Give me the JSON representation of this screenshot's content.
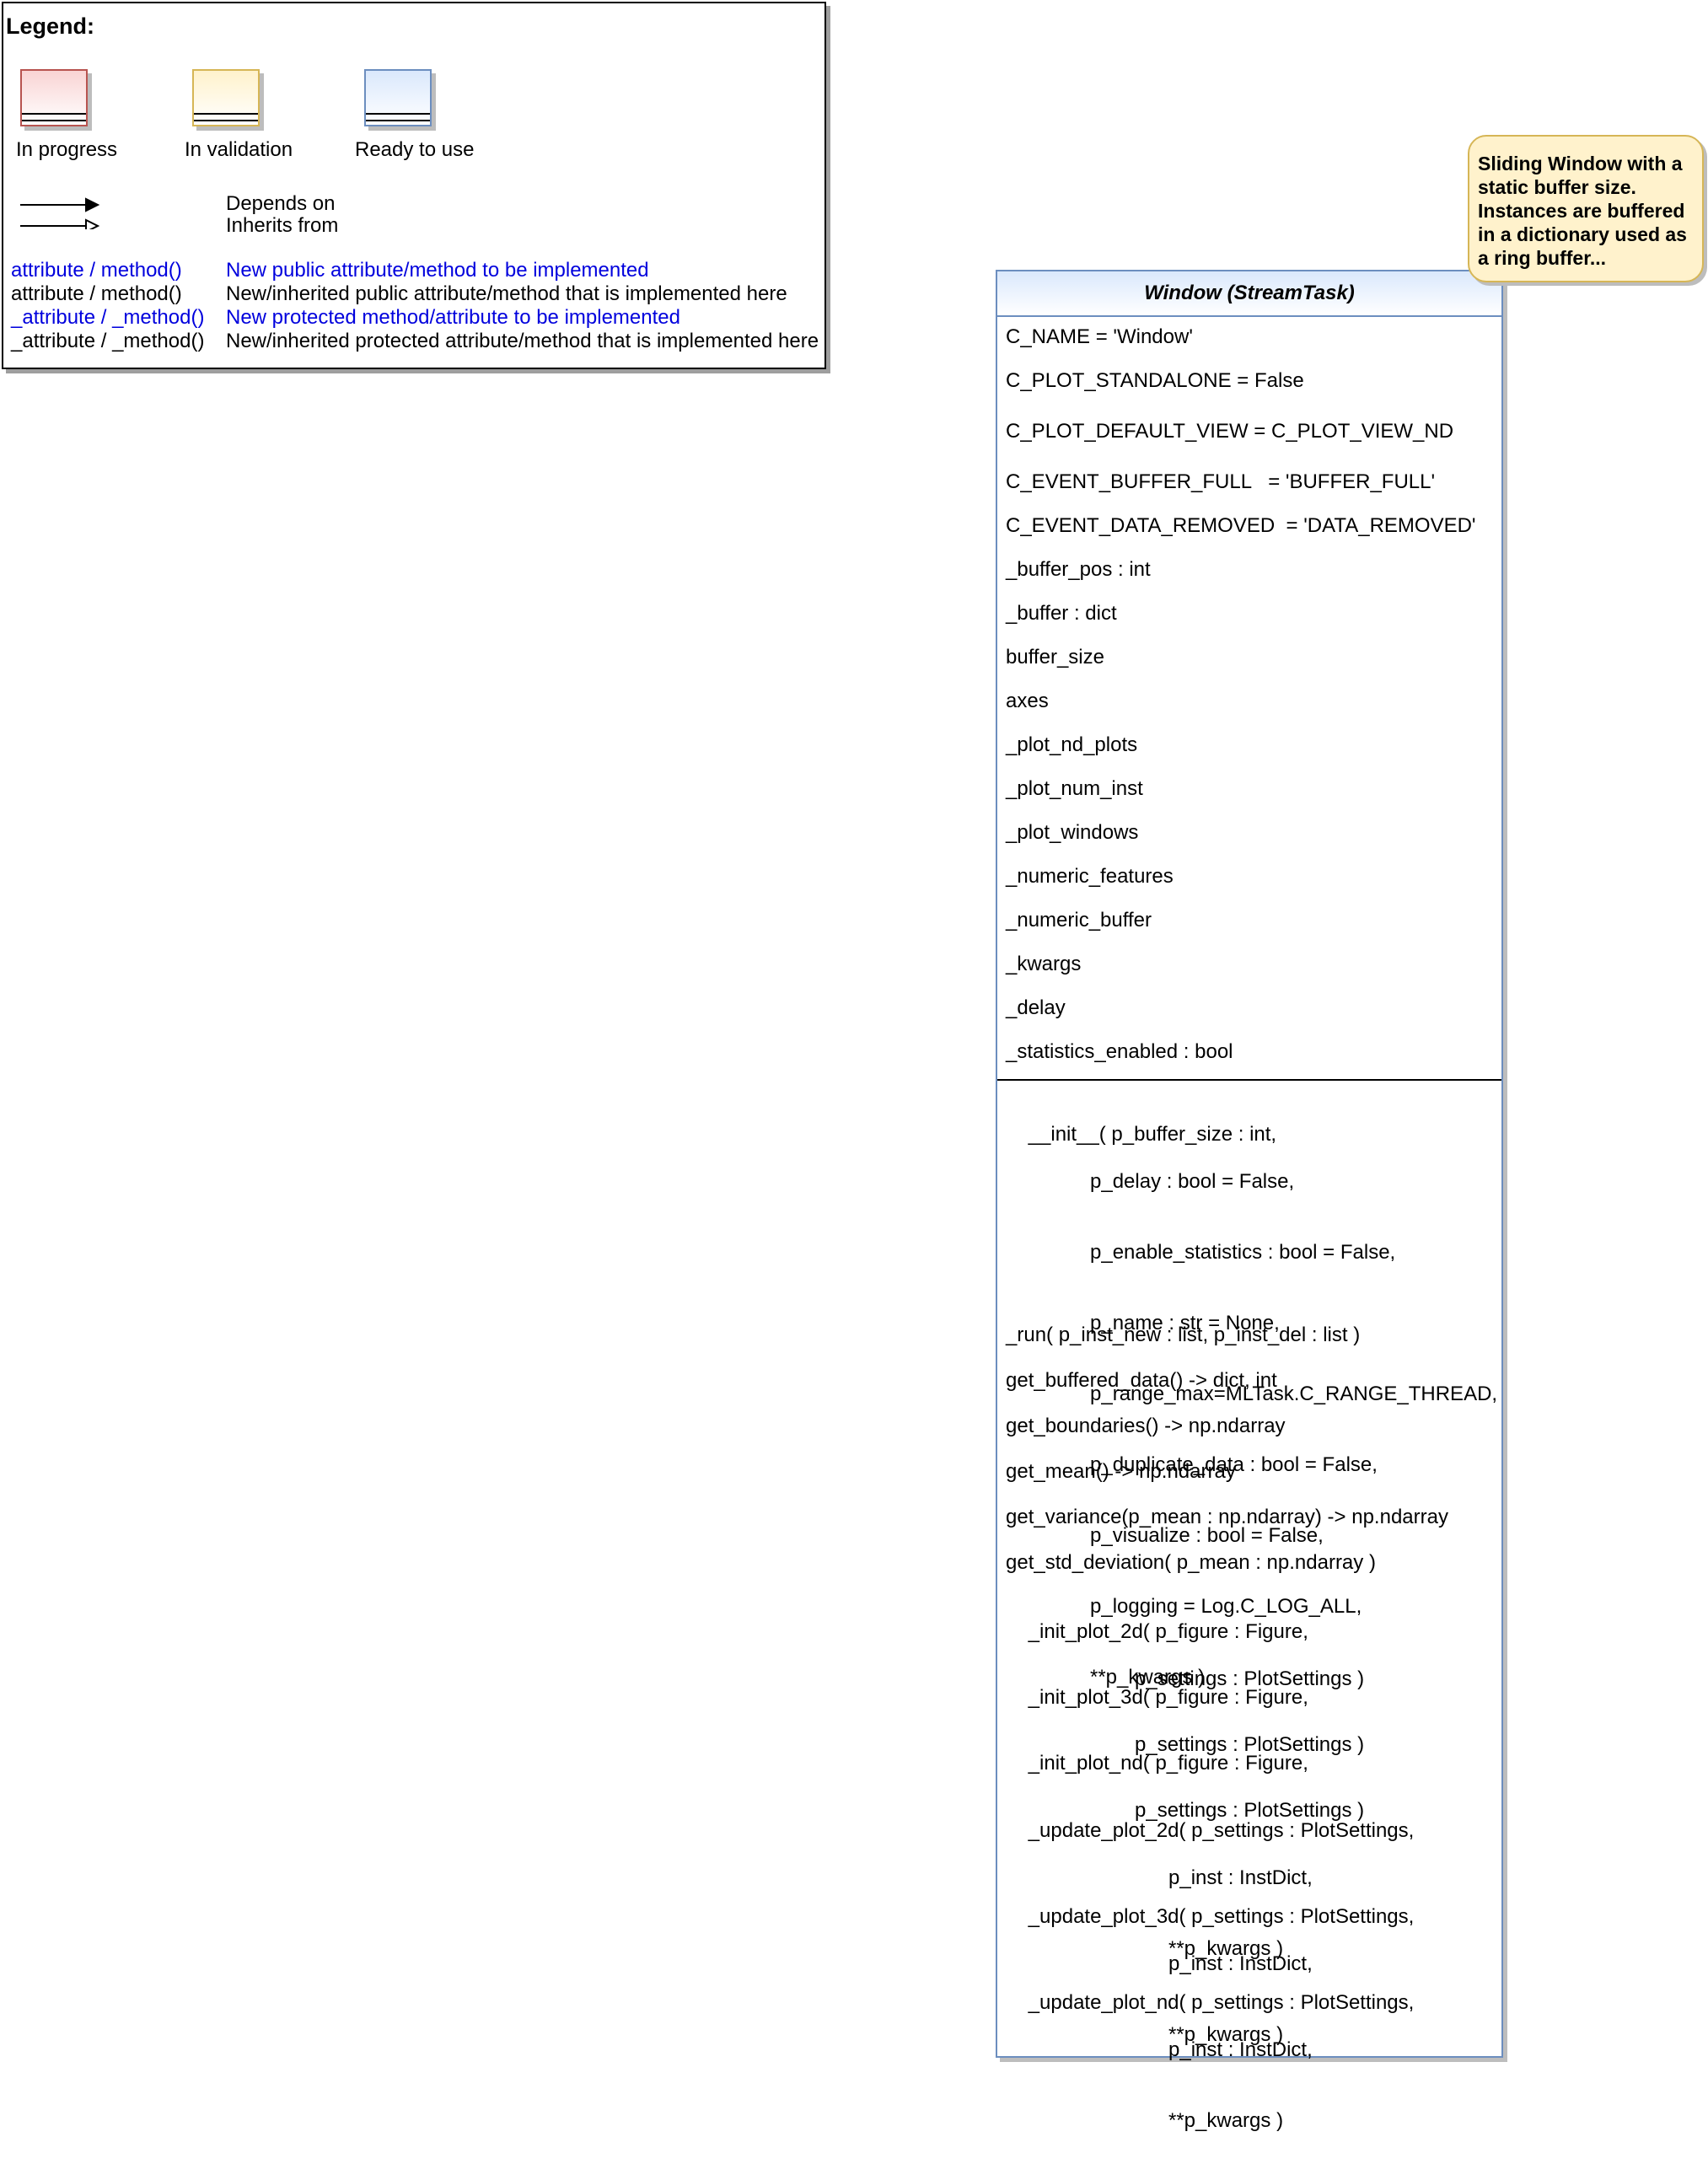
{
  "legend": {
    "title": "Legend:",
    "statuses": [
      {
        "label": "In progress",
        "color": "#b85450"
      },
      {
        "label": "In validation",
        "color": "#d6b656"
      },
      {
        "label": "Ready to use",
        "color": "#6c8ebf"
      }
    ],
    "arrows": {
      "depends_on": "Depends on",
      "inherits_from": "Inherits from"
    },
    "conventions": [
      {
        "code": "attribute / method()",
        "desc": "New public attribute/method to be implemented",
        "color": "#0000dd"
      },
      {
        "code": "attribute / method()",
        "desc": "New/inherited public attribute/method that is implemented here",
        "color": "#000000"
      },
      {
        "code": "_attribute / _method()",
        "desc": "New protected method/attribute to be implemented",
        "color": "#0000dd"
      },
      {
        "code": "_attribute / _method()",
        "desc": "New/inherited protected attribute/method that is implemented here",
        "color": "#000000"
      }
    ]
  },
  "class_box": {
    "title": "Window (StreamTask)",
    "attributes": [
      "C_NAME = 'Window'",
      "C_PLOT_STANDALONE = False",
      "C_PLOT_DEFAULT_VIEW = C_PLOT_VIEW_ND",
      "C_EVENT_BUFFER_FULL   = 'BUFFER_FULL'",
      "C_EVENT_DATA_REMOVED  = 'DATA_REMOVED'",
      "_buffer_pos : int",
      "_buffer : dict",
      "buffer_size",
      "axes",
      "_plot_nd_plots",
      "_plot_num_inst",
      "_plot_windows",
      "_numeric_features",
      "_numeric_buffer",
      "_kwargs",
      "_delay",
      "_statistics_enabled : bool"
    ],
    "init_method": {
      "first": "__init__( p_buffer_size : int,",
      "rest": [
        "p_delay : bool = False,",
        "p_enable_statistics : bool = False,",
        "p_name : str = None,",
        "p_range_max=MLTask.C_RANGE_THREAD,",
        "p_duplicate_data : bool = False,",
        "p_visualize : bool = False,",
        "p_logging = Log.C_LOG_ALL,",
        "**p_kwargs )"
      ]
    },
    "methods": [
      "_run( p_inst_new : list, p_inst_del : list )",
      "get_buffered_data() -> dict, int",
      "get_boundaries() -> np.ndarray",
      "get_mean() -> np.ndarray",
      "get_variance(p_mean : np.ndarray) -> np.ndarray",
      "get_std_deviation( p_mean : np.ndarray )"
    ],
    "plot_init_methods": [
      {
        "first": "_init_plot_2d( p_figure : Figure,",
        "rest": [
          "p_settings : PlotSettings )"
        ]
      },
      {
        "first": "_init_plot_3d( p_figure : Figure,",
        "rest": [
          "p_settings : PlotSettings )"
        ]
      },
      {
        "first": "_init_plot_nd( p_figure : Figure,",
        "rest": [
          "p_settings : PlotSettings )"
        ]
      }
    ],
    "plot_update_methods": [
      {
        "first": "_update_plot_2d( p_settings : PlotSettings,",
        "rest": [
          "p_inst : InstDict,",
          "**p_kwargs )"
        ]
      },
      {
        "first": "_update_plot_3d( p_settings : PlotSettings,",
        "rest": [
          "p_inst : InstDict,",
          "**p_kwargs )"
        ]
      },
      {
        "first": "_update_plot_nd( p_settings : PlotSettings,",
        "rest": [
          "p_inst : InstDict,",
          "**p_kwargs )"
        ]
      }
    ]
  },
  "note": {
    "text": "Sliding Window with a static buffer size. Instances are buffered in a dictionary used as a ring buffer..."
  }
}
